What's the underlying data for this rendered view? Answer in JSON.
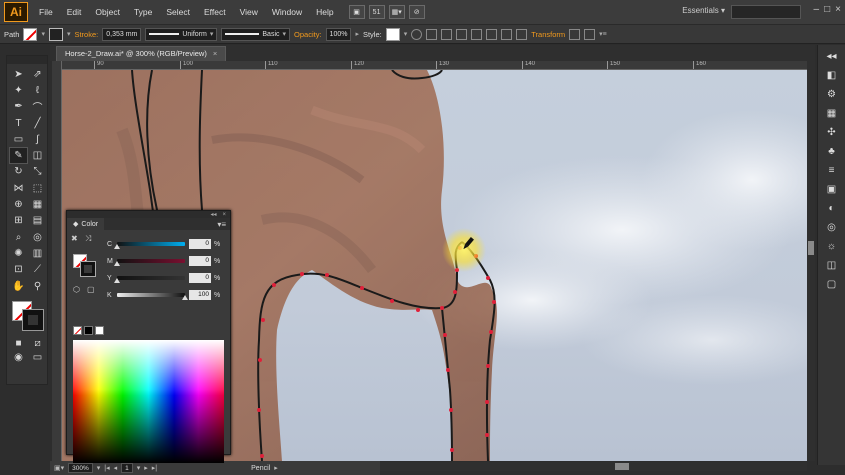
{
  "app": {
    "logo": "Ai"
  },
  "menu": [
    "File",
    "Edit",
    "Object",
    "Type",
    "Select",
    "Effect",
    "View",
    "Window",
    "Help"
  ],
  "menubar_icons": {
    "arrange_value": "51"
  },
  "workspace": {
    "essentials": "Essentials"
  },
  "control_bar": {
    "object_type": "Path",
    "stroke_label": "Stroke:",
    "stroke_weight": "0,353 mm",
    "profile": "Uniform",
    "brush": "Basic",
    "opacity_label": "Opacity:",
    "opacity_value": "100%",
    "style_label": "Style:",
    "transform_label": "Transform"
  },
  "document": {
    "tab_title": "Horse-2_Draw.ai* @ 300% (RGB/Preview)",
    "close": "×"
  },
  "ruler": {
    "ticks": [
      "90",
      "100",
      "110",
      "120",
      "130",
      "140",
      "150",
      "160"
    ]
  },
  "color_panel": {
    "title": "Color",
    "header_controls": [
      "◂◂",
      "×"
    ],
    "channels": [
      {
        "label": "C",
        "value": "0",
        "unit": "%",
        "fraction": 0.0
      },
      {
        "label": "M",
        "value": "0",
        "unit": "%",
        "fraction": 0.0
      },
      {
        "label": "Y",
        "value": "0",
        "unit": "%",
        "fraction": 0.0
      },
      {
        "label": "K",
        "value": "100",
        "unit": "%",
        "fraction": 1.0
      }
    ]
  },
  "status_bar": {
    "zoom": "300%",
    "artboard": "1",
    "tool": "Pencil"
  },
  "colors": {
    "accent_orange": "#f29a1d",
    "sky": "#c6cfdc",
    "horse": "#8a4a2a",
    "anchor": "#e0203a",
    "highlight": "#ffe22a"
  }
}
